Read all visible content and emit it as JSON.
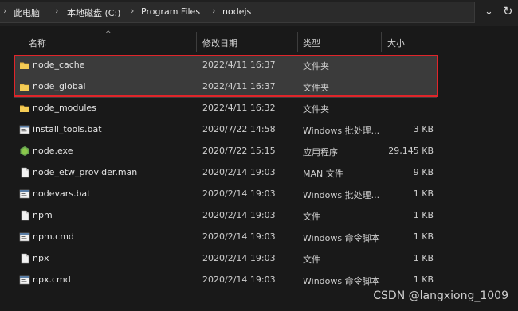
{
  "breadcrumb": {
    "items": [
      "此电脑",
      "本地磁盘 (C:)",
      "Program Files",
      "nodejs"
    ]
  },
  "columns": {
    "name": "名称",
    "date": "修改日期",
    "type": "类型",
    "size": "大小"
  },
  "files": [
    {
      "name": "node_cache",
      "date": "2022/4/11 16:37",
      "type": "文件夹",
      "size": "",
      "icon": "folder-icon"
    },
    {
      "name": "node_global",
      "date": "2022/4/11 16:37",
      "type": "文件夹",
      "size": "",
      "icon": "folder-icon"
    },
    {
      "name": "node_modules",
      "date": "2022/4/11 16:32",
      "type": "文件夹",
      "size": "",
      "icon": "folder-icon"
    },
    {
      "name": "install_tools.bat",
      "date": "2020/7/22 14:58",
      "type": "Windows 批处理...",
      "size": "3 KB",
      "icon": "batch-file-icon"
    },
    {
      "name": "node.exe",
      "date": "2020/7/22 15:15",
      "type": "应用程序",
      "size": "29,145 KB",
      "icon": "node-exe-icon"
    },
    {
      "name": "node_etw_provider.man",
      "date": "2020/2/14 19:03",
      "type": "MAN 文件",
      "size": "9 KB",
      "icon": "file-icon"
    },
    {
      "name": "nodevars.bat",
      "date": "2020/2/14 19:03",
      "type": "Windows 批处理...",
      "size": "1 KB",
      "icon": "batch-file-icon"
    },
    {
      "name": "npm",
      "date": "2020/2/14 19:03",
      "type": "文件",
      "size": "1 KB",
      "icon": "file-icon"
    },
    {
      "name": "npm.cmd",
      "date": "2020/2/14 19:03",
      "type": "Windows 命令脚本",
      "size": "1 KB",
      "icon": "batch-file-icon"
    },
    {
      "name": "npx",
      "date": "2020/2/14 19:03",
      "type": "文件",
      "size": "1 KB",
      "icon": "file-icon"
    },
    {
      "name": "npx.cmd",
      "date": "2020/2/14 19:03",
      "type": "Windows 命令脚本",
      "size": "1 KB",
      "icon": "batch-file-icon"
    }
  ],
  "watermark": "CSDN @langxiong_1009"
}
